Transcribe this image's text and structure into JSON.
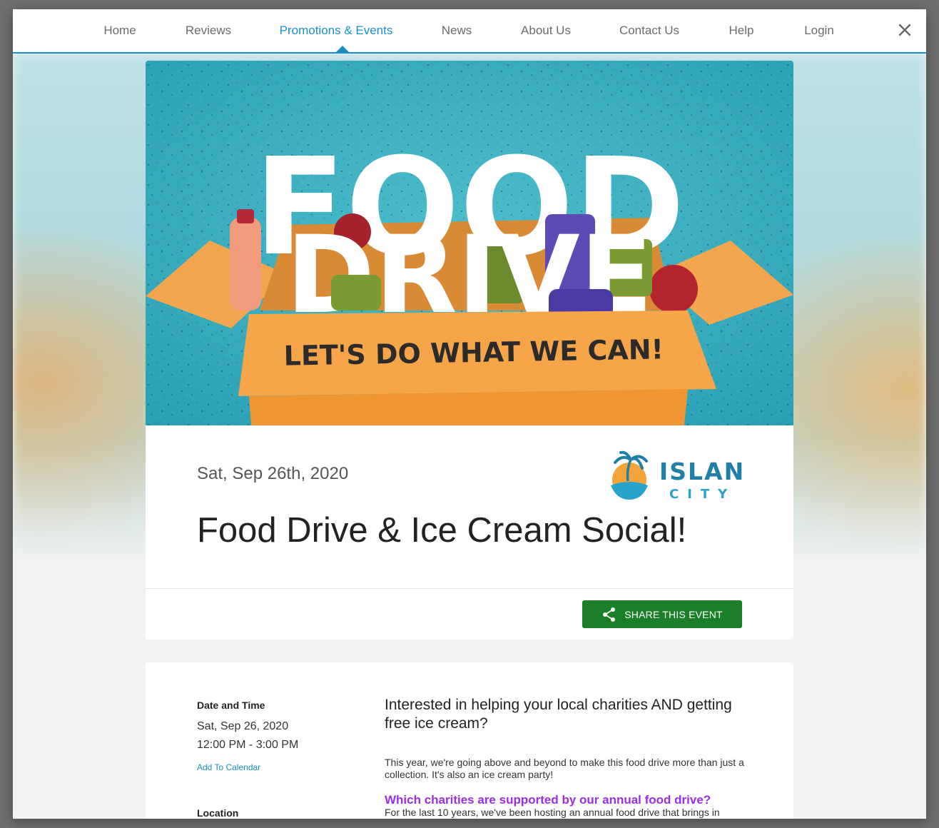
{
  "nav": {
    "items": [
      {
        "label": "Home"
      },
      {
        "label": "Reviews"
      },
      {
        "label": "Promotions & Events"
      },
      {
        "label": "News"
      },
      {
        "label": "About Us"
      },
      {
        "label": "Contact Us"
      },
      {
        "label": "Help"
      },
      {
        "label": "Login"
      }
    ],
    "active_index": 2
  },
  "banner": {
    "headline_top": "FOOD",
    "headline_bottom": "DRIVE",
    "tagline": "LET'S DO WHAT WE CAN!"
  },
  "event": {
    "date": "Sat, Sep 26th, 2020",
    "title": "Food Drive & Ice Cream Social!",
    "share_label": "SHARE THIS EVENT"
  },
  "logo": {
    "line1": "ISLAND",
    "line2": "CITY"
  },
  "details": {
    "date_time_label": "Date and Time",
    "date": "Sat, Sep 26, 2020",
    "time": "12:00 PM - 3:00 PM",
    "add_calendar": "Add To Calendar",
    "location_label": "Location"
  },
  "description": {
    "heading": "Interested in helping your local charities AND getting free ice cream?",
    "paragraph": "This year, we're going above and beyond to make this food drive more than just a collection. It's also an ice cream party!",
    "subheading": "Which charities are supported by our annual food drive?",
    "paragraph2": "For the last 10 years, we've been hosting an annual food drive that brings in"
  },
  "colors": {
    "accent": "#1a8fc9",
    "share_button": "#1b7f2a",
    "subheading": "#9b2ee6"
  }
}
